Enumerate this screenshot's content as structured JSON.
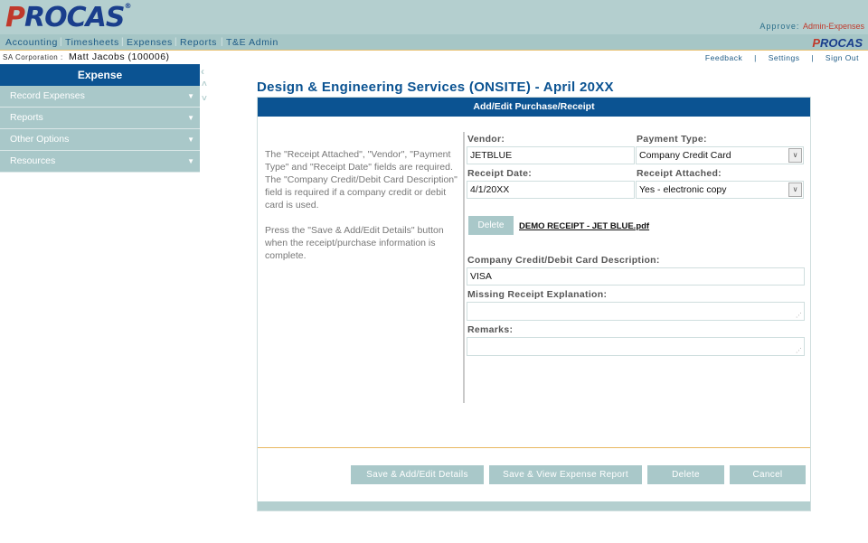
{
  "app": {
    "logo_text": "ROCAS",
    "logo_initial": "P"
  },
  "approve": {
    "label": "Approve:",
    "link": "Admin-Expenses"
  },
  "nav": {
    "items": [
      "Accounting",
      "Timesheets",
      "Expenses",
      "Reports",
      "T&E Admin"
    ],
    "mini_logo": "ROCAS",
    "mini_logo_initial": "P"
  },
  "user": {
    "corp": "SA Corporation :",
    "name": "Matt Jacobs (100006)"
  },
  "toplinks": [
    "Feedback",
    "Settings",
    "Sign Out"
  ],
  "sidebar": {
    "header": "Expense",
    "items": [
      {
        "label": "Record Expenses"
      },
      {
        "label": "Reports"
      },
      {
        "label": "Other Options"
      },
      {
        "label": "Resources"
      }
    ]
  },
  "page": {
    "title": "Design & Engineering Services (ONSITE) - April 20XX"
  },
  "panel": {
    "header": "Add/Edit Purchase/Receipt",
    "help_1": "The \"Receipt Attached\", \"Vendor\", \"Payment Type\" and \"Receipt Date\" fields are required. The \"Company Credit/Debit Card Description\" field is required if a company credit or debit card is used.",
    "help_2": "Press the \"Save & Add/Edit Details\" button when the receipt/purchase information is complete."
  },
  "form": {
    "vendor_label": "Vendor:",
    "vendor_value": "JETBLUE",
    "payment_label": "Payment Type:",
    "payment_value": "Company Credit Card",
    "date_label": "Receipt Date:",
    "date_value": "4/1/20XX",
    "attached_label": "Receipt Attached:",
    "attached_value": "Yes - electronic copy",
    "delete_label": "Delete",
    "file_name": "DEMO RECEIPT - JET BLUE.pdf",
    "card_label": "Company Credit/Debit Card Description:",
    "card_value": "VISA",
    "missing_label": "Missing Receipt Explanation:",
    "remarks_label": "Remarks:"
  },
  "buttons": {
    "save_add": "Save & Add/Edit Details",
    "save_view": "Save & View Expense Report",
    "delete": "Delete",
    "cancel": "Cancel"
  }
}
